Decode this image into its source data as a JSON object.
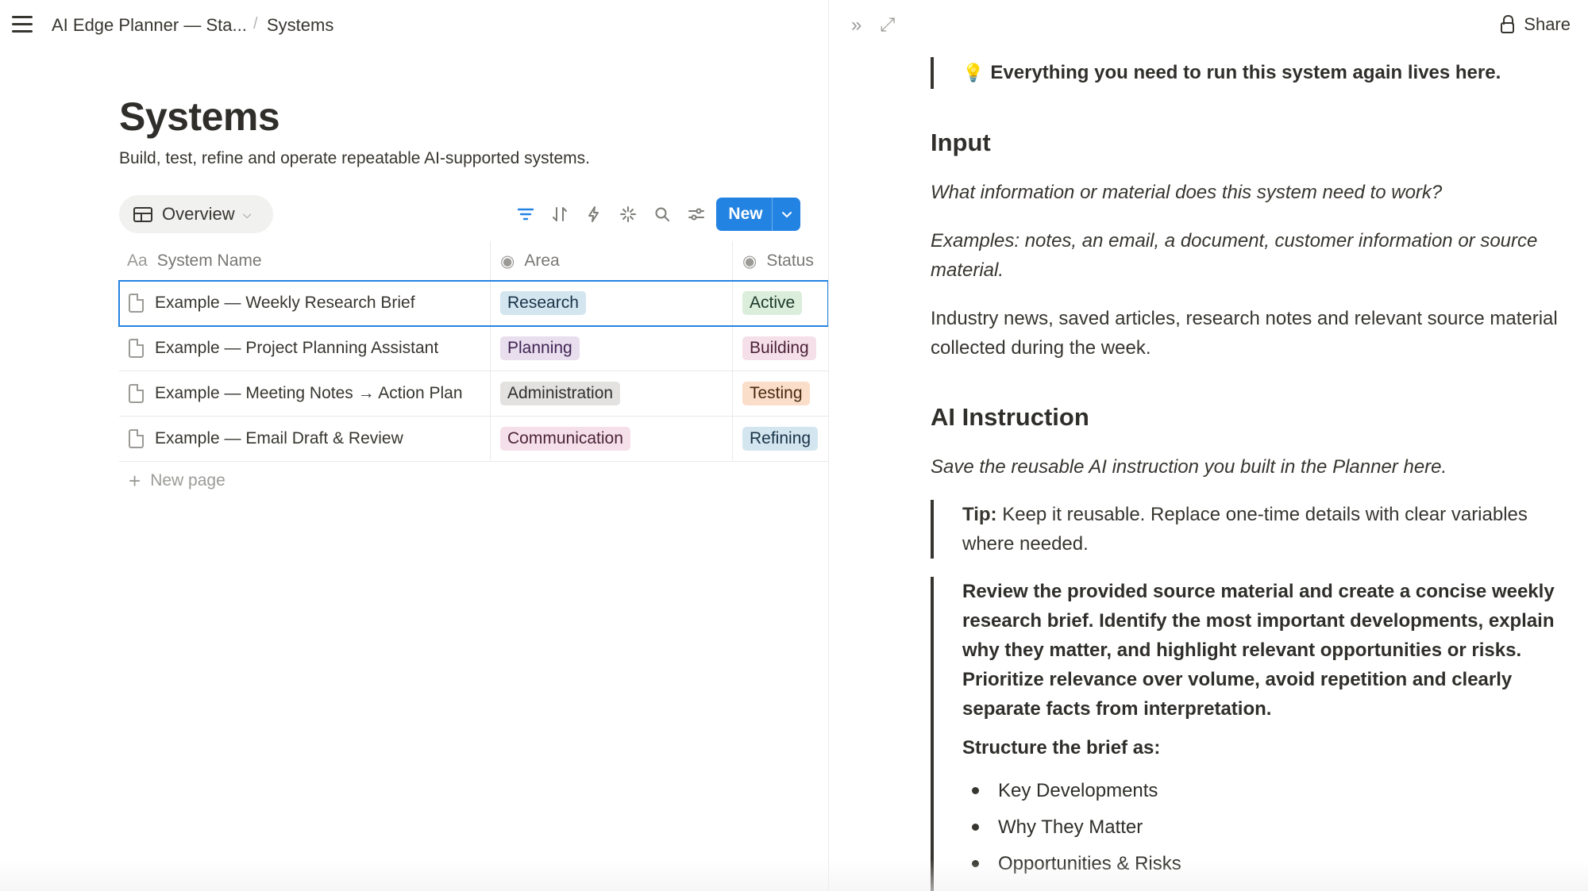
{
  "breadcrumb": {
    "workspace": "AI Edge Planner — Sta...",
    "separator": "/",
    "current": "Systems"
  },
  "page": {
    "title": "Systems",
    "description": "Build, test, refine and operate repeatable AI-supported systems."
  },
  "view": {
    "label": "Overview"
  },
  "toolbar": {
    "new_label": "New"
  },
  "table": {
    "columns": {
      "name": "System Name",
      "area": "Area",
      "status": "Status"
    },
    "rows": [
      {
        "name": "Example — Weekly Research Brief",
        "area": "Research",
        "status": "Active"
      },
      {
        "name": "Example — Project Planning Assistant",
        "area": "Planning",
        "status": "Building"
      },
      {
        "name": "Example — Meeting Notes → Action Plan",
        "area": "Administration",
        "status": "Testing"
      },
      {
        "name": "Example — Email Draft & Review",
        "area": "Communication",
        "status": "Refining"
      }
    ],
    "new_page_label": "New page"
  },
  "tag_colors": {
    "Research": {
      "bg": "#d3e5ef",
      "fg": "#183347"
    },
    "Planning": {
      "bg": "#e8deee",
      "fg": "#412454"
    },
    "Administration": {
      "bg": "#e3e2e0",
      "fg": "#32302c"
    },
    "Communication": {
      "bg": "#f5e0e9",
      "fg": "#4c2337"
    },
    "Active": {
      "bg": "#dbeddb",
      "fg": "#1c3829"
    },
    "Building": {
      "bg": "#f5e0e9",
      "fg": "#4c2337"
    },
    "Testing": {
      "bg": "#fadec9",
      "fg": "#49290e"
    },
    "Refining": {
      "bg": "#d3e5ef",
      "fg": "#183347"
    }
  },
  "detail": {
    "share_label": "Share",
    "callout": "Everything you need to run this system again lives here.",
    "input_heading": "Input",
    "input_question": "What information or material does this system need to work?",
    "input_examples": "Examples: notes, an email, a document, customer information or source material.",
    "input_value": "Industry news, saved articles, research notes and relevant source material collected during the week.",
    "ai_heading": "AI Instruction",
    "ai_hint": "Save the reusable AI instruction you built in the Planner here.",
    "tip_label": "Tip:",
    "tip_text": " Keep it reusable. Replace one-time details with clear variables where needed.",
    "instruction": "Review the provided source material and create a concise weekly research brief. Identify the most important developments, explain why they matter, and highlight relevant opportunities or risks. Prioritize relevance over volume, avoid repetition and clearly separate facts from interpretation.",
    "structure_label": "Structure the brief as:",
    "structure_items": [
      "Key Developments",
      "Why They Matter",
      "Opportunities & Risks"
    ]
  }
}
